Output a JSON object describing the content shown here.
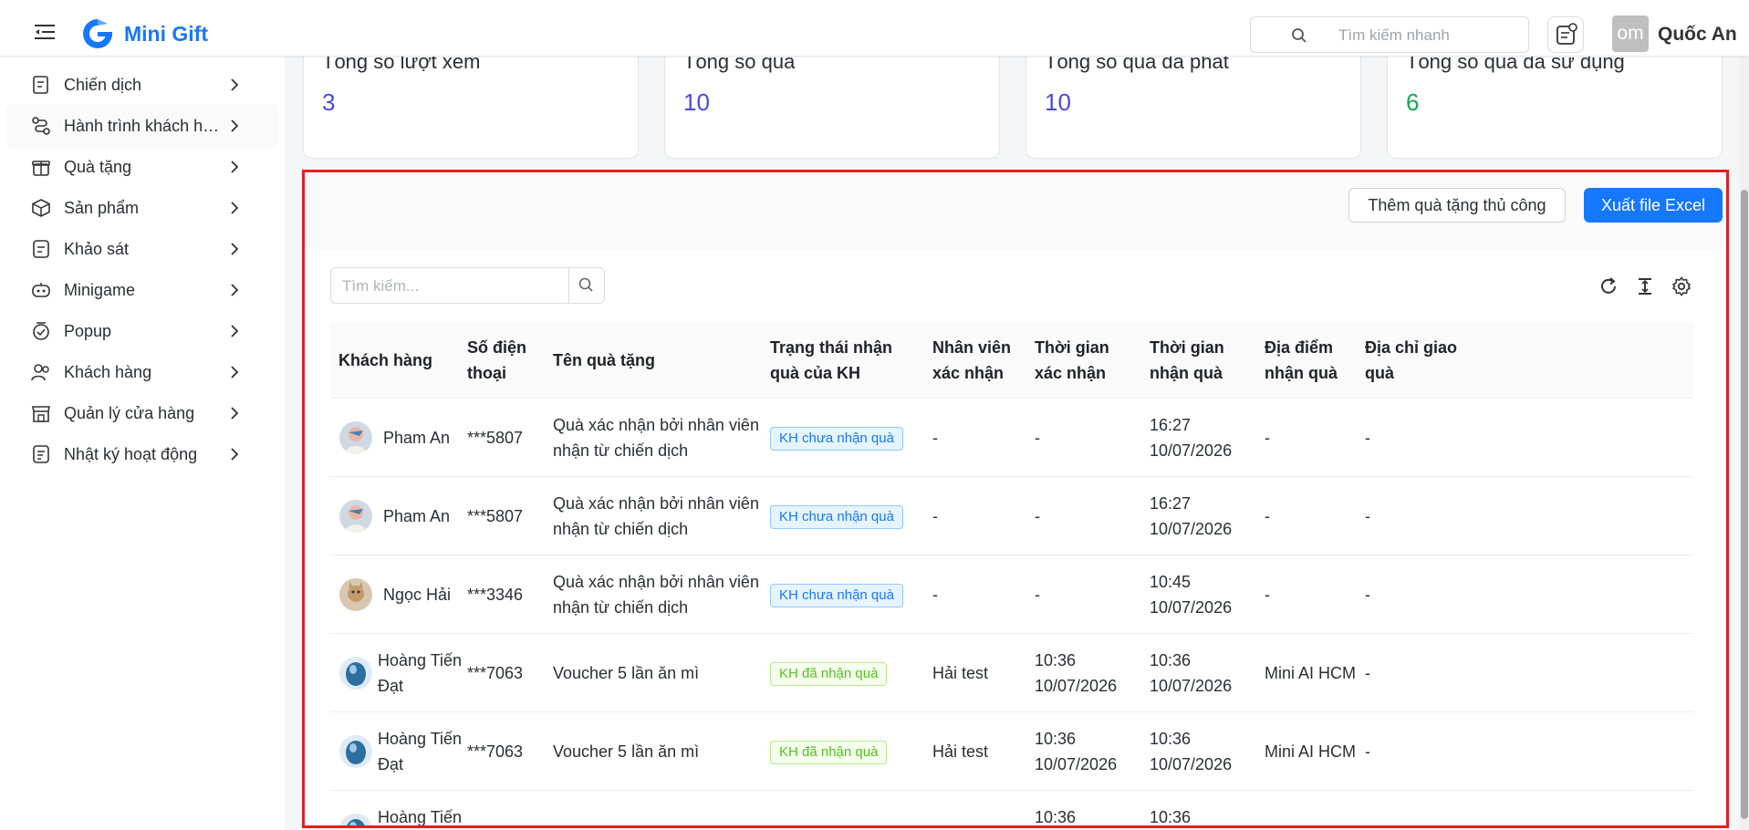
{
  "header": {
    "logo_text": "Mini Gift",
    "search_placeholder": "Tìm kiếm nhanh",
    "avatar_initials": "om",
    "user_name": "Quốc An"
  },
  "sidebar": {
    "items": [
      {
        "label": "Chiến dịch",
        "icon": "campaign-icon"
      },
      {
        "label": "Hành trình khách hàng",
        "icon": "journey-icon"
      },
      {
        "label": "Quà tặng",
        "icon": "gift-icon"
      },
      {
        "label": "Sản phẩm",
        "icon": "product-box-icon"
      },
      {
        "label": "Khảo sát",
        "icon": "survey-icon"
      },
      {
        "label": "Minigame",
        "icon": "gamepad-icon"
      },
      {
        "label": "Popup",
        "icon": "popup-icon"
      },
      {
        "label": "Khách hàng",
        "icon": "customers-icon"
      },
      {
        "label": "Quản lý cửa hàng",
        "icon": "store-icon"
      },
      {
        "label": "Nhật ký hoạt động",
        "icon": "activity-log-icon"
      }
    ]
  },
  "stats": [
    {
      "label": "Tổng số lượt xem",
      "value": "3"
    },
    {
      "label": "Tổng số quà",
      "value": "10"
    },
    {
      "label": "Tổng số quà đã phát",
      "value": "10"
    },
    {
      "label": "Tổng số quà đã sử dụng",
      "value": "6"
    }
  ],
  "colors": {
    "primary": "#1677ff",
    "stat_value": "#4a49e0",
    "stat_value_used": "#1aa551",
    "highlight_border": "#e02020"
  },
  "toolbar": {
    "add_manual_label": "Thêm quà tặng thủ công",
    "export_excel_label": "Xuất file Excel"
  },
  "table": {
    "search_placeholder": "Tìm kiếm...",
    "headers": {
      "customer": "Khách hàng",
      "phone": "Số điện thoại",
      "gift_name": "Tên quà tặng",
      "receive_status": "Trạng thái nhận quà của KH",
      "confirm_staff": "Nhân viên xác nhận",
      "confirm_time": "Thời gian xác nhận",
      "receive_time": "Thời gian nhận quà",
      "location": "Địa điểm nhận quà",
      "delivery_address": "Địa chỉ giao quà"
    },
    "rows": [
      {
        "customer": "Pham An",
        "phone": "***5807",
        "gift": "Quà xác nhận bởi nhân viên nhận từ chiến dịch",
        "status": "KH chưa nhận quà",
        "staff": "-",
        "confirm_time": "-",
        "receive_time": "16:27 10/07/2026",
        "location": "-",
        "address": "-"
      },
      {
        "customer": "Pham An",
        "phone": "***5807",
        "gift": "Quà xác nhận bởi nhân viên nhận từ chiến dịch",
        "status": "KH chưa nhận quà",
        "staff": "-",
        "confirm_time": "-",
        "receive_time": "16:27 10/07/2026",
        "location": "-",
        "address": "-"
      },
      {
        "customer": "Ngọc Hải",
        "phone": "***3346",
        "gift": "Quà xác nhận bởi nhân viên nhận từ chiến dịch",
        "status": "KH chưa nhận quà",
        "staff": "-",
        "confirm_time": "-",
        "receive_time": "10:45 10/07/2026",
        "location": "-",
        "address": "-"
      },
      {
        "customer": "Hoàng Tiến Đạt",
        "phone": "***7063",
        "gift": "Voucher 5 lần ăn mì",
        "status": "KH đã nhận quà",
        "staff": "Hải test",
        "confirm_time": "10:36 10/07/2026",
        "receive_time": "10:36 10/07/2026",
        "location": "Mini AI HCM",
        "address": "-"
      },
      {
        "customer": "Hoàng Tiến Đạt",
        "phone": "***7063",
        "gift": "Voucher 5 lần ăn mì",
        "status": "KH đã nhận quà",
        "staff": "Hải test",
        "confirm_time": "10:36 10/07/2026",
        "receive_time": "10:36 10/07/2026",
        "location": "Mini AI HCM",
        "address": "-"
      },
      {
        "customer": "Hoàng Tiến",
        "confirm_time": "10:36",
        "receive_time": "10:36"
      }
    ]
  }
}
